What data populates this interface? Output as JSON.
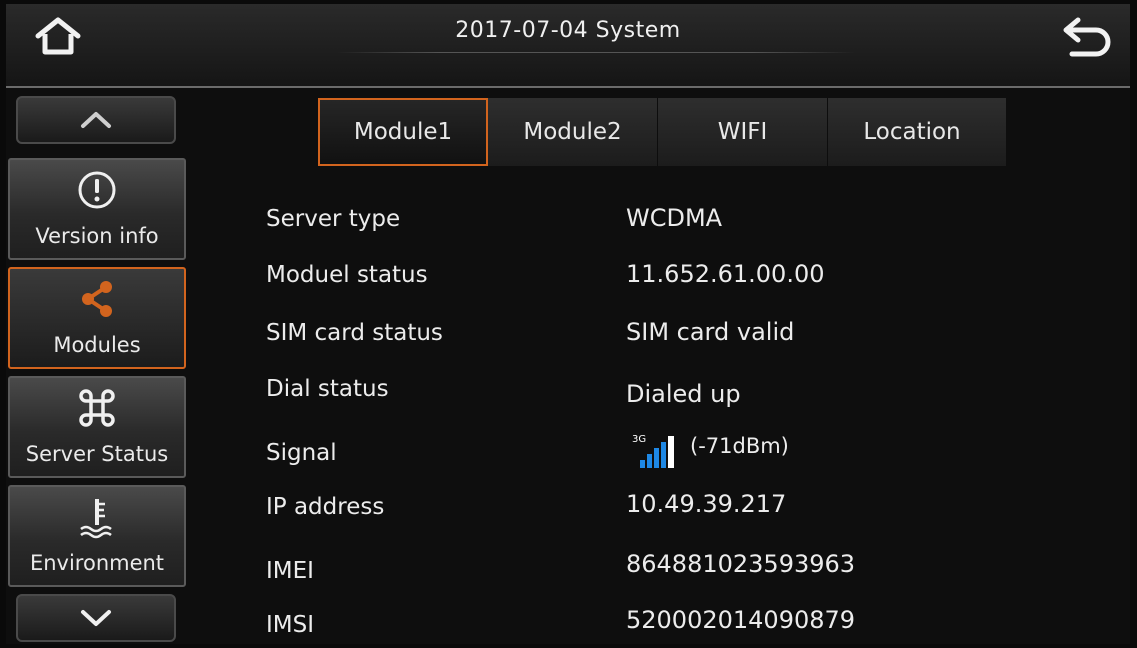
{
  "header": {
    "title": "2017-07-04  System"
  },
  "sidebar": {
    "items": [
      {
        "label": "Version info",
        "icon": "info-icon"
      },
      {
        "label": "Modules",
        "icon": "share-icon"
      },
      {
        "label": "Server Status",
        "icon": "command-icon"
      },
      {
        "label": "Environment",
        "icon": "temperature-icon"
      }
    ],
    "active": "Modules"
  },
  "tabs": [
    {
      "label": "Module1"
    },
    {
      "label": "Module2"
    },
    {
      "label": "WIFI"
    },
    {
      "label": "Location"
    }
  ],
  "active_tab": "Module1",
  "info": {
    "server_type": {
      "label": "Server type",
      "value": "WCDMA"
    },
    "module_status": {
      "label": "Moduel status",
      "value": "11.652.61.00.00"
    },
    "sim_status": {
      "label": "SIM card status",
      "value": "SIM card valid"
    },
    "dial_status": {
      "label": "Dial status",
      "value": "Dialed up"
    },
    "signal": {
      "label": "Signal",
      "network": "3G",
      "value": "(-71dBm)"
    },
    "ip": {
      "label": "IP address",
      "value": "10.49.39.217"
    },
    "imei": {
      "label": "IMEI",
      "value": "864881023593963"
    },
    "imsi": {
      "label": "IMSI",
      "value": "520002014090879"
    }
  },
  "colors": {
    "accent": "#d2641e",
    "signal": "#1e88e5"
  }
}
